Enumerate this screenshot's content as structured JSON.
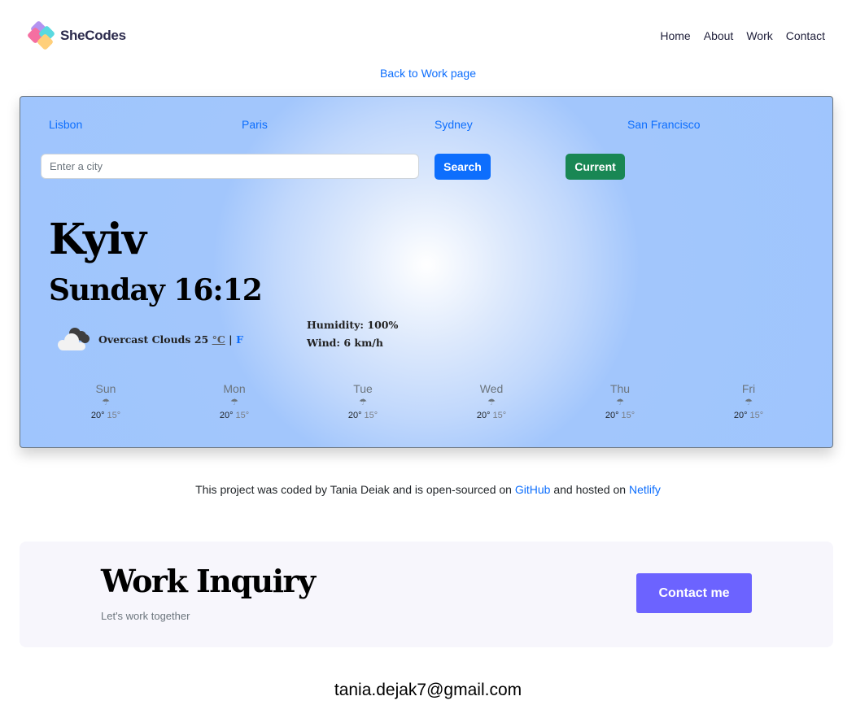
{
  "header": {
    "logo_text": "SheCodes",
    "nav": [
      "Home",
      "About",
      "Work",
      "Contact"
    ]
  },
  "back_link": "Back to Work page",
  "weather": {
    "cities": [
      "Lisbon",
      "Paris",
      "Sydney",
      "San Francisco"
    ],
    "search": {
      "placeholder": "Enter a city",
      "value": "",
      "search_label": "Search",
      "current_label": "Current"
    },
    "city": "Kyiv",
    "date_time": "Sunday 16:12",
    "current": {
      "icon": "overcast-clouds-icon",
      "description": "Overcast Clouds",
      "temperature": "25",
      "unit_c": "°C",
      "separator": "|",
      "unit_f": "F"
    },
    "humidity": "Humidity: 100%",
    "wind": "Wind: 6 km/h",
    "forecast": [
      {
        "day": "Sun",
        "icon": "umbrella-icon",
        "max": "20°",
        "min": "15°"
      },
      {
        "day": "Mon",
        "icon": "umbrella-icon",
        "max": "20°",
        "min": "15°"
      },
      {
        "day": "Tue",
        "icon": "umbrella-icon",
        "max": "20°",
        "min": "15°"
      },
      {
        "day": "Wed",
        "icon": "umbrella-icon",
        "max": "20°",
        "min": "15°"
      },
      {
        "day": "Thu",
        "icon": "umbrella-icon",
        "max": "20°",
        "min": "15°"
      },
      {
        "day": "Fri",
        "icon": "umbrella-icon",
        "max": "20°",
        "min": "15°"
      }
    ]
  },
  "credit": {
    "prefix": "This project was coded by Tania Deiak and is open-sourced on",
    "github": "GitHub",
    "middle": "and hosted on",
    "netlify": "Netlify"
  },
  "inquiry": {
    "title": "Work Inquiry",
    "subtitle": "Let's work together",
    "button": "Contact me"
  },
  "email": "tania.dejak7@gmail.com",
  "colors": {
    "primary": "#0d6efd",
    "success": "#198754",
    "accent": "#6c63ff",
    "card_bg": "#9fc5fd"
  }
}
